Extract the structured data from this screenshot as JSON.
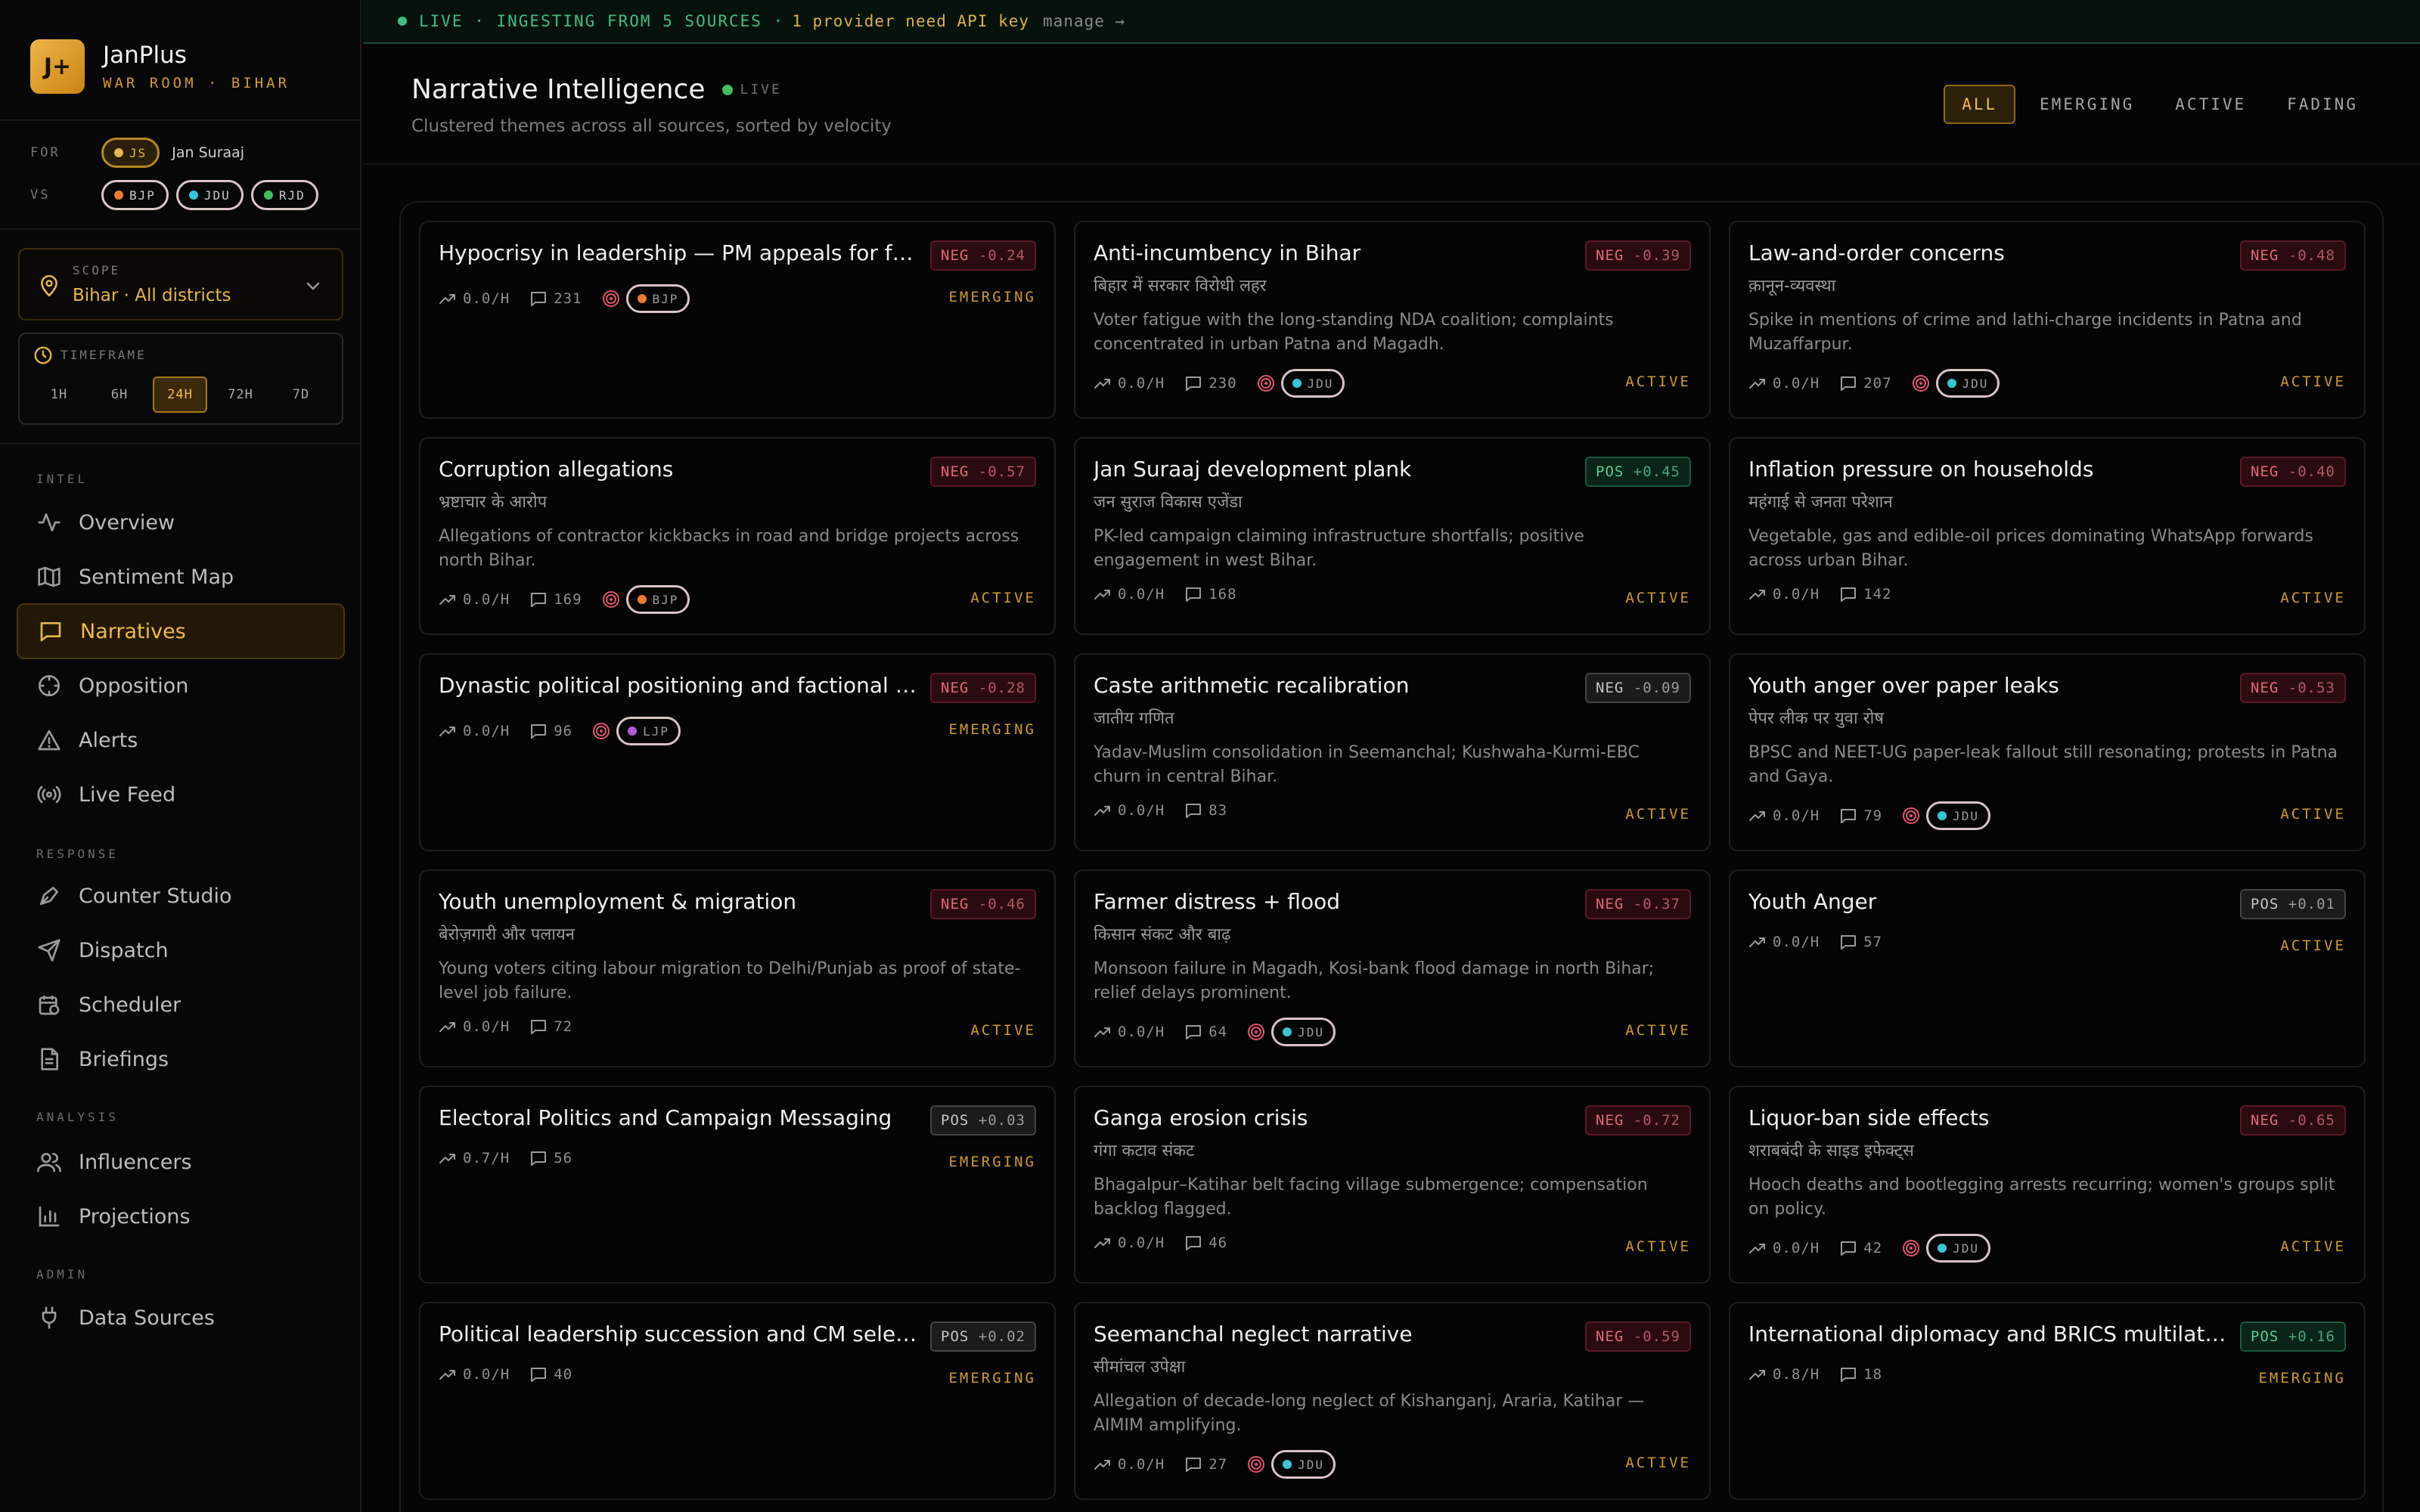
{
  "brand": {
    "logo": "J+",
    "name": "JanPlus",
    "subtitle": "WAR ROOM · BIHAR"
  },
  "for_vs": {
    "for_label": "FOR",
    "for_chip": {
      "label": "JS",
      "dot_color": "#e5b54a"
    },
    "for_name": "Jan Suraaj",
    "vs_label": "VS",
    "vs_chips": [
      {
        "label": "BJP",
        "dot_color": "#f07a2a"
      },
      {
        "label": "JDU",
        "dot_color": "#34c6d9"
      },
      {
        "label": "RJD",
        "dot_color": "#3fbf60"
      }
    ]
  },
  "scope": {
    "label": "SCOPE",
    "value": "Bihar · All districts",
    "icon": "map-pin-icon"
  },
  "timeframe": {
    "label": "TIMEFRAME",
    "options": [
      "1H",
      "6H",
      "24H",
      "72H",
      "7D"
    ],
    "selected": "24H"
  },
  "nav": {
    "sections": [
      {
        "label": "INTEL",
        "items": [
          {
            "label": "Overview",
            "icon": "activity-icon"
          },
          {
            "label": "Sentiment Map",
            "icon": "map-icon"
          },
          {
            "label": "Narratives",
            "icon": "message-square-icon",
            "active": true
          },
          {
            "label": "Opposition",
            "icon": "crosshair-icon"
          },
          {
            "label": "Alerts",
            "icon": "alert-triangle-icon"
          },
          {
            "label": "Live Feed",
            "icon": "broadcast-icon"
          }
        ]
      },
      {
        "label": "RESPONSE",
        "items": [
          {
            "label": "Counter Studio",
            "icon": "pen-icon"
          },
          {
            "label": "Dispatch",
            "icon": "send-icon"
          },
          {
            "label": "Scheduler",
            "icon": "calendar-clock-icon"
          },
          {
            "label": "Briefings",
            "icon": "file-text-icon"
          }
        ]
      },
      {
        "label": "ANALYSIS",
        "items": [
          {
            "label": "Influencers",
            "icon": "users-icon"
          },
          {
            "label": "Projections",
            "icon": "bar-chart-icon"
          }
        ]
      },
      {
        "label": "ADMIN",
        "items": [
          {
            "label": "Data Sources",
            "icon": "plug-icon"
          }
        ]
      }
    ]
  },
  "topbar": {
    "live_text": "LIVE · INGESTING FROM 5 SOURCES ·",
    "warning_text": "1 provider need API key",
    "manage_text": "manage →",
    "live_color": "#3fbf7f"
  },
  "header": {
    "title": "Narrative Intelligence",
    "live_label": "LIVE",
    "subtitle": "Clustered themes across all sources, sorted by velocity",
    "filters": [
      "ALL",
      "EMERGING",
      "ACTIVE",
      "FADING"
    ],
    "selected_filter": "ALL"
  },
  "cards": [
    {
      "title": "Hypocrisy in leadership — PM appeals for fuel co…",
      "sentiment": "NEG",
      "score": "-0.24",
      "hindi": "",
      "desc": "",
      "velocity": "0.0/H",
      "mentions": "231",
      "party": "BJP",
      "status": "EMERGING"
    },
    {
      "title": "Anti-incumbency in Bihar",
      "sentiment": "NEG",
      "score": "-0.39",
      "hindi": "बिहार में सरकार विरोधी लहर",
      "desc": "Voter fatigue with the long-standing NDA coalition; complaints concentrated in urban Patna and Magadh.",
      "velocity": "0.0/H",
      "mentions": "230",
      "party": "JDU",
      "status": "ACTIVE"
    },
    {
      "title": "Law-and-order concerns",
      "sentiment": "NEG",
      "score": "-0.48",
      "hindi": "क़ानून-व्यवस्था",
      "desc": "Spike in mentions of crime and lathi-charge incidents in Patna and Muzaffarpur.",
      "velocity": "0.0/H",
      "mentions": "207",
      "party": "JDU",
      "status": "ACTIVE"
    },
    {
      "title": "Corruption allegations",
      "sentiment": "NEG",
      "score": "-0.57",
      "hindi": "भ्रष्टाचार के आरोप",
      "desc": "Allegations of contractor kickbacks in road and bridge projects across north Bihar.",
      "velocity": "0.0/H",
      "mentions": "169",
      "party": "BJP",
      "status": "ACTIVE"
    },
    {
      "title": "Jan Suraaj development plank",
      "sentiment": "POS",
      "score": "+0.45",
      "hindi": "जन सुराज विकास एजेंडा",
      "desc": "PK-led campaign claiming infrastructure shortfalls; positive engagement in west Bihar.",
      "velocity": "0.0/H",
      "mentions": "168",
      "party": "",
      "status": "ACTIVE"
    },
    {
      "title": "Inflation pressure on households",
      "sentiment": "NEG",
      "score": "-0.40",
      "hindi": "महंगाई से जनता परेशान",
      "desc": "Vegetable, gas and edible-oil prices dominating WhatsApp forwards across urban Bihar.",
      "velocity": "0.0/H",
      "mentions": "142",
      "party": "",
      "status": "ACTIVE"
    },
    {
      "title": "Dynastic political positioning and factional realign…",
      "sentiment": "NEG",
      "score": "-0.28",
      "hindi": "",
      "desc": "",
      "velocity": "0.0/H",
      "mentions": "96",
      "party": "LJP",
      "status": "EMERGING"
    },
    {
      "title": "Caste arithmetic recalibration",
      "sentiment": "NEG",
      "score": "-0.09",
      "hindi": "जातीय गणित",
      "desc": "Yadav-Muslim consolidation in Seemanchal; Kushwaha-Kurmi-EBC churn in central Bihar.",
      "velocity": "0.0/H",
      "mentions": "83",
      "party": "",
      "status": "ACTIVE",
      "neutral": true
    },
    {
      "title": "Youth anger over paper leaks",
      "sentiment": "NEG",
      "score": "-0.53",
      "hindi": "पेपर लीक पर युवा रोष",
      "desc": "BPSC and NEET-UG paper-leak fallout still resonating; protests in Patna and Gaya.",
      "velocity": "0.0/H",
      "mentions": "79",
      "party": "JDU",
      "status": "ACTIVE"
    },
    {
      "title": "Youth unemployment & migration",
      "sentiment": "NEG",
      "score": "-0.46",
      "hindi": "बेरोज़गारी और पलायन",
      "desc": "Young voters citing labour migration to Delhi/Punjab as proof of state-level job failure.",
      "velocity": "0.0/H",
      "mentions": "72",
      "party": "",
      "status": "ACTIVE"
    },
    {
      "title": "Farmer distress + flood",
      "sentiment": "NEG",
      "score": "-0.37",
      "hindi": "किसान संकट और बाढ़",
      "desc": "Monsoon failure in Magadh, Kosi-bank flood damage in north Bihar; relief delays prominent.",
      "velocity": "0.0/H",
      "mentions": "64",
      "party": "JDU",
      "status": "ACTIVE"
    },
    {
      "title": "Youth Anger",
      "sentiment": "POS",
      "score": "+0.01",
      "hindi": "",
      "desc": "",
      "velocity": "0.0/H",
      "mentions": "57",
      "party": "",
      "status": "ACTIVE",
      "neutral": true
    },
    {
      "title": "Electoral Politics and Campaign Messaging",
      "sentiment": "POS",
      "score": "+0.03",
      "hindi": "",
      "desc": "",
      "velocity": "0.7/H",
      "mentions": "56",
      "party": "",
      "status": "EMERGING",
      "neutral": true
    },
    {
      "title": "Ganga erosion crisis",
      "sentiment": "NEG",
      "score": "-0.72",
      "hindi": "गंगा कटाव संकट",
      "desc": "Bhagalpur–Katihar belt facing village submergence; compensation backlog flagged.",
      "velocity": "0.0/H",
      "mentions": "46",
      "party": "",
      "status": "ACTIVE"
    },
    {
      "title": "Liquor-ban side effects",
      "sentiment": "NEG",
      "score": "-0.65",
      "hindi": "शराबबंदी के साइड इफेक्ट्स",
      "desc": "Hooch deaths and bootlegging arrests recurring; women's groups split on policy.",
      "velocity": "0.0/H",
      "mentions": "42",
      "party": "JDU",
      "status": "ACTIVE"
    },
    {
      "title": "Political leadership succession and CM selection",
      "sentiment": "POS",
      "score": "+0.02",
      "hindi": "",
      "desc": "",
      "velocity": "0.0/H",
      "mentions": "40",
      "party": "",
      "status": "EMERGING",
      "neutral": true
    },
    {
      "title": "Seemanchal neglect narrative",
      "sentiment": "NEG",
      "score": "-0.59",
      "hindi": "सीमांचल उपेक्षा",
      "desc": "Allegation of decade-long neglect of Kishanganj, Araria, Katihar — AIMIM amplifying.",
      "velocity": "0.0/H",
      "mentions": "27",
      "party": "JDU",
      "status": "ACTIVE"
    },
    {
      "title": "International diplomacy and BRICS multilateral en…",
      "sentiment": "POS",
      "score": "+0.16",
      "hindi": "",
      "desc": "",
      "velocity": "0.8/H",
      "mentions": "18",
      "party": "",
      "status": "EMERGING"
    }
  ],
  "party_colors": {
    "BJP": "#f07a2a",
    "JDU": "#34c6d9",
    "LJP": "#b15ad9"
  },
  "accent_color": "#e5b54a"
}
